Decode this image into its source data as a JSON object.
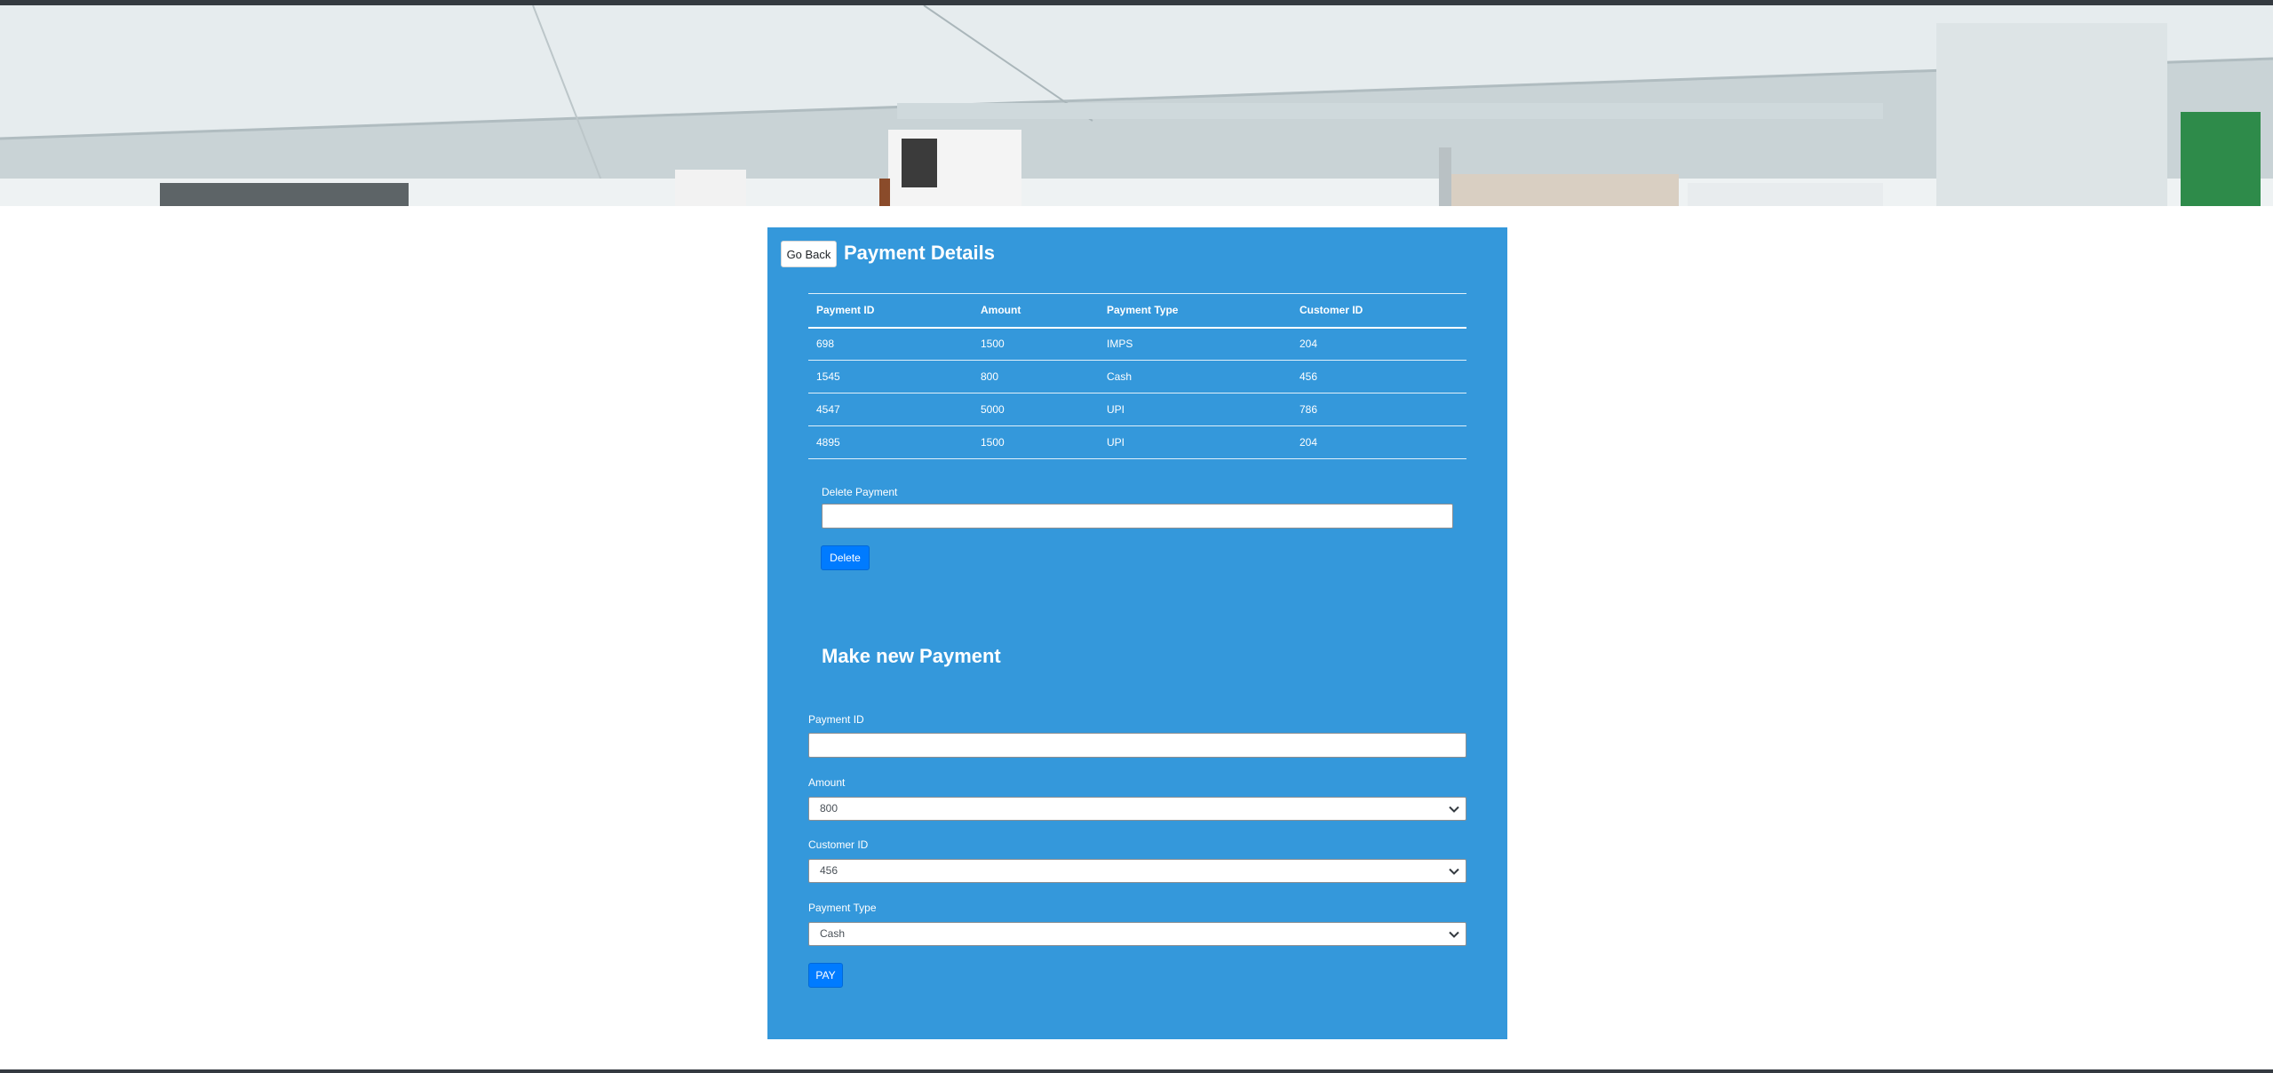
{
  "colors": {
    "panel": "#3498db",
    "primary_button": "#007bff",
    "topbar": "#343a40"
  },
  "header": {
    "go_back_label": "Go Back",
    "title": "Payment Details"
  },
  "table": {
    "columns": [
      "Payment ID",
      "Amount",
      "Payment Type",
      "Customer ID"
    ],
    "rows": [
      [
        "698",
        "1500",
        "IMPS",
        "204"
      ],
      [
        "1545",
        "800",
        "Cash",
        "456"
      ],
      [
        "4547",
        "5000",
        "UPI",
        "786"
      ],
      [
        "4895",
        "1500",
        "UPI",
        "204"
      ]
    ]
  },
  "delete_form": {
    "label": "Delete Payment",
    "value": "",
    "button_label": "Delete"
  },
  "new_payment": {
    "title": "Make new Payment",
    "payment_id": {
      "label": "Payment ID",
      "value": ""
    },
    "amount": {
      "label": "Amount",
      "selected": "800"
    },
    "customer_id": {
      "label": "Customer ID",
      "selected": "456"
    },
    "payment_type": {
      "label": "Payment Type",
      "selected": "Cash"
    },
    "pay_button_label": "PAY"
  },
  "icons": {
    "select_arrow": "chevron-down-icon"
  }
}
